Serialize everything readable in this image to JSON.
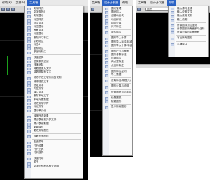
{
  "left_window": {
    "menubar": [
      "帮助(E)",
      "文件(F)",
      "工具箱"
    ],
    "menu_items": [
      "文字样式",
      "文字查找S",
      "文字显示",
      "标注样式",
      "标注文字",
      "标注显示",
      "断面文字",
      "标注显示",
      "删除尺寸标注",
      "引线标注",
      "标注A",
      "坐标标注",
      "多坐标标注",
      "---",
      "快速选择",
      "选择条件过滤",
      "快速消除",
      "将数据变为文字",
      "将数据替换文字",
      "---",
      "修改不在文字方向的说明",
      "修改增强文本",
      "指定文字",
      "向量文字",
      "建立文字",
      "删除本地文字",
      "本地对象数据",
      "修改文字字符",
      "标记文字",
      "显示单元格",
      "---",
      "转换所选对象",
      "导出表格到外部文件",
      "导入表格数据",
      "更新属性",
      "更改文字属性",
      "---",
      "拆散为多段线",
      "---",
      "右键菜单",
      "打开设置",
      "打开工具",
      "打开选择",
      "---",
      "快速打印",
      "关于",
      "文字识别程序相关说明"
    ]
  },
  "middle_window": {
    "menubar": [
      "工具箱",
      "设计开发器",
      "帮助"
    ],
    "menu_items": [
      "图块管理",
      "图块插入",
      "创建动态块",
      "动态修改",
      "动态计算",
      "尺寸标注",
      "---",
      "属性标注",
      "---",
      "图形导入计算",
      "图形导入标注(标准图)",
      "图形导入计算(平面)",
      "---",
      "图形尺寸与截面",
      "图形参数标注",
      "连续标注",
      "两点型标注",
      "点坐标标注",
      "---",
      "图形标注控制",
      "导入数据",
      "---",
      "获取标注(带图元)",
      "---",
      "图形计算与说明",
      "---",
      "设置图块显示样式",
      "---",
      "绘制圆弧",
      "绘制图形",
      "---",
      "显示所有图形"
    ]
  },
  "right_window": {
    "menubar": [
      "工具箱",
      "设计开发器",
      "帮助"
    ],
    "combo_value": "图层",
    "menu_items": [
      "输入源码生成",
      "输入说明文件",
      "输入使用说明",
      "输入说明",
      "---",
      "计算图标点位坐标",
      "计算图形所有面积与坐标",
      "计算范围的平面面积",
      "---",
      "写出所有图形",
      "---",
      "平铺窗口"
    ]
  },
  "colors": {
    "menu_highlight": "#2b63c6",
    "canvas": "#000000",
    "crosshair": "#1ca11c"
  }
}
